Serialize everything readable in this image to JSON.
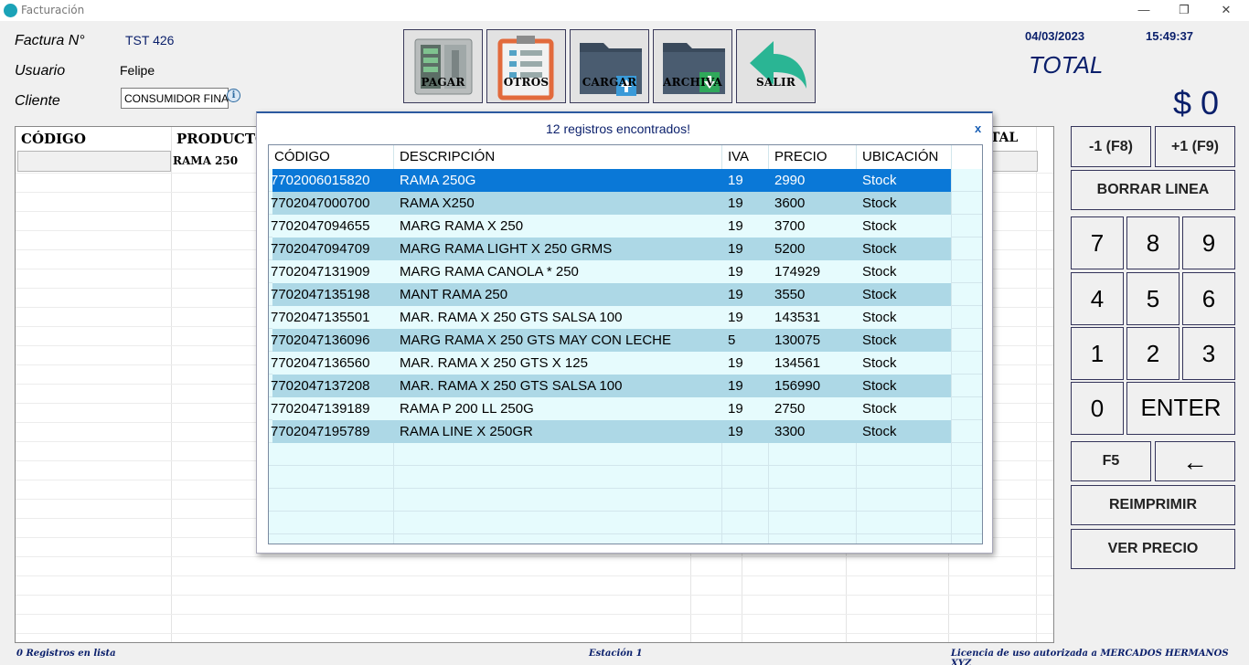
{
  "window": {
    "title": "Facturación",
    "minimize": "—",
    "maximize": "❐",
    "close": "✕"
  },
  "header": {
    "factura_label": "Factura N°",
    "factura_value": "TST 426",
    "usuario_label": "Usuario",
    "usuario_value": "Felipe",
    "cliente_label": "Cliente",
    "cliente_value": "CONSUMIDOR FINAL",
    "date": "04/03/2023",
    "time": "15:49:37",
    "total_label": "TOTAL",
    "total_value": "$ 0"
  },
  "toolbar": {
    "pagar": "PAGAR",
    "otros": "OTROS",
    "cargar": "CARGAR",
    "archiva": "ARCHIVA",
    "salir": "SALIR"
  },
  "grid": {
    "col_codigo": "CÓDIGO",
    "col_producto": "PRODUCTO",
    "col_total": "TAL",
    "row1_producto": "RAMA 250"
  },
  "popup": {
    "message": "12 registros encontrados!",
    "close": "x",
    "columns": [
      "CÓDIGO",
      "DESCRIPCIÓN",
      "IVA",
      "PRECIO",
      "UBICACIÓN"
    ],
    "rows": [
      [
        "7702006015820",
        "RAMA 250G",
        "19",
        "2990",
        "Stock"
      ],
      [
        "7702047000700",
        "RAMA X250",
        "19",
        "3600",
        "Stock"
      ],
      [
        "7702047094655",
        "MARG RAMA X 250",
        "19",
        "3700",
        "Stock"
      ],
      [
        "7702047094709",
        "MARG RAMA LIGHT X 250 GRMS",
        "19",
        "5200",
        "Stock"
      ],
      [
        "7702047131909",
        "MARG RAMA CANOLA * 250",
        "19",
        "174929",
        "Stock"
      ],
      [
        "7702047135198",
        "MANT RAMA 250",
        "19",
        "3550",
        "Stock"
      ],
      [
        "7702047135501",
        "MAR. RAMA X 250 GTS SALSA 100",
        "19",
        "143531",
        "Stock"
      ],
      [
        "7702047136096",
        "MARG RAMA X 250 GTS MAY CON LECHE",
        "5",
        "130075",
        "Stock"
      ],
      [
        "7702047136560",
        "MAR. RAMA X 250 GTS X 125",
        "19",
        "134561",
        "Stock"
      ],
      [
        "7702047137208",
        "MAR. RAMA X 250 GTS SALSA 100",
        "19",
        "156990",
        "Stock"
      ],
      [
        "7702047139189",
        "RAMA P 200 LL 250G",
        "19",
        "2750",
        "Stock"
      ],
      [
        "7702047195789",
        "RAMA LINE X 250GR",
        "19",
        "3300",
        "Stock"
      ]
    ],
    "selected_row": 0
  },
  "keypad": {
    "minus": "-1 (F8)",
    "plus": "+1 (F9)",
    "borrar": "BORRAR LINEA",
    "k7": "7",
    "k8": "8",
    "k9": "9",
    "k4": "4",
    "k5": "5",
    "k6": "6",
    "k1": "1",
    "k2": "2",
    "k3": "3",
    "k0": "0",
    "enter": "ENTER",
    "f5": "F5",
    "back": "←",
    "reimprimir": "REIMPRIMIR",
    "ver_precio": "VER PRECIO"
  },
  "status": {
    "registros": "0 Registros en lista",
    "estacion": "Estación 1",
    "licencia": "Licencia de uso autorizada a MERCADOS HERMANOS XYZ"
  },
  "colors": {
    "navy": "#0a1f6b",
    "selected": "#0a78d7",
    "row_alt": "#add8e6",
    "row_light": "#e6fbfd"
  }
}
